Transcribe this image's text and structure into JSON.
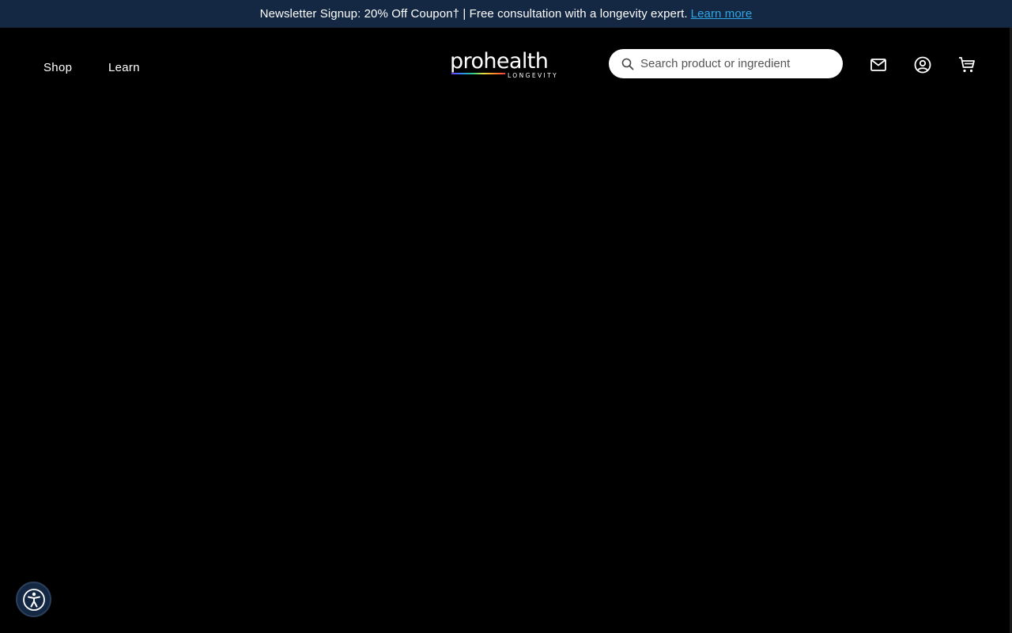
{
  "announcement": {
    "text": "Newsletter Signup: 20% Off Coupon† | Free consultation with a longevity expert.",
    "link_label": "Learn more"
  },
  "nav": {
    "items": [
      {
        "label": "Shop"
      },
      {
        "label": "Learn"
      }
    ]
  },
  "logo": {
    "wordmark": "prohealth",
    "tagline": "LONGEVITY"
  },
  "search": {
    "placeholder": "Search product or ingredient",
    "value": ""
  },
  "header_icons": [
    "mail-icon",
    "account-icon",
    "cart-icon"
  ],
  "accessibility": {
    "icon": "accessibility-icon"
  },
  "colors": {
    "page_background": "#000000",
    "announcement_background": "#142843",
    "link": "#2ea6e6",
    "search_background": "#ffffff"
  }
}
